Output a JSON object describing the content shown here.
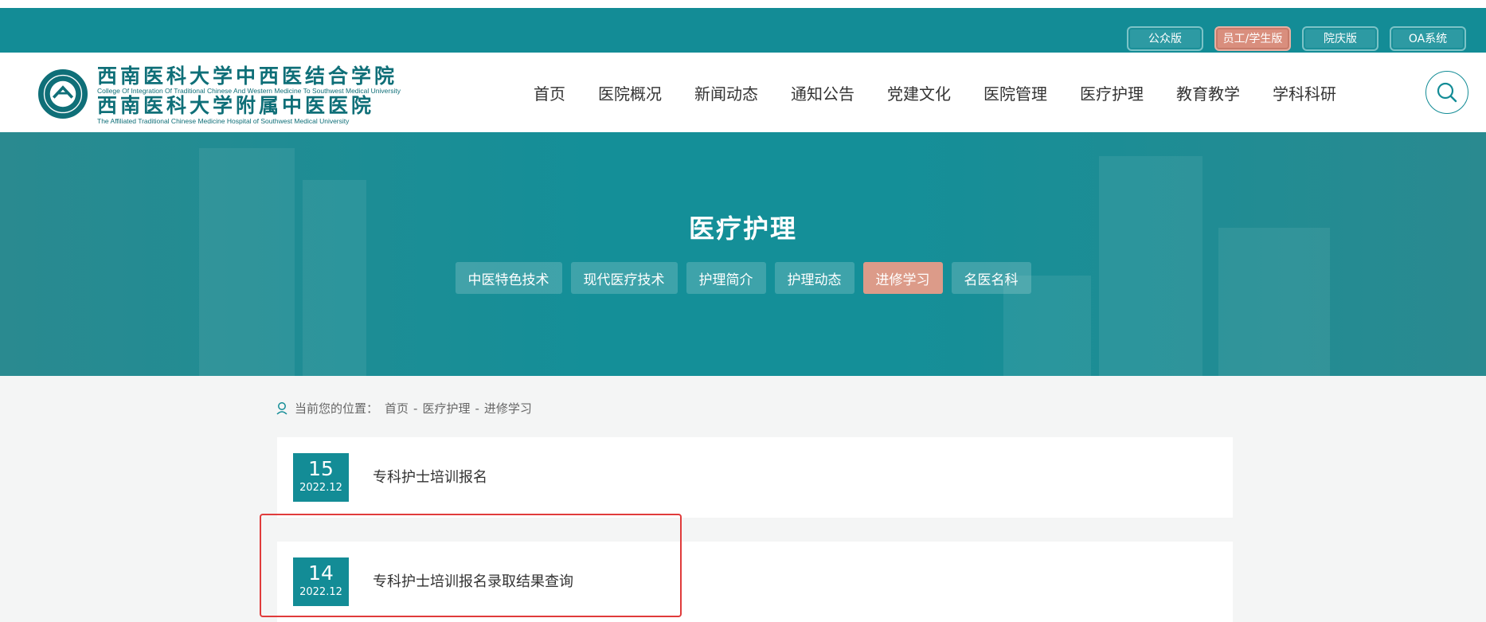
{
  "top_links": [
    {
      "label": "公众版",
      "active": false
    },
    {
      "label": "员工/学生版",
      "active": true
    },
    {
      "label": "院庆版",
      "active": false
    },
    {
      "label": "OA系统",
      "active": false
    }
  ],
  "logo": {
    "cn_line1": "西南医科大学中西医结合学院",
    "en_line1": "College Of Integration Of Traditional Chinese And Western Medicine To Southwest Medical University",
    "cn_line2": "西南医科大学附属中医医院",
    "en_line2": "The Affiliated Traditional Chinese Medicine Hospital of Southwest Medical University"
  },
  "nav": [
    "首页",
    "医院概况",
    "新闻动态",
    "通知公告",
    "党建文化",
    "医院管理",
    "医疗护理",
    "教育教学",
    "学科科研"
  ],
  "banner": {
    "title": "医疗护理",
    "subnav": [
      {
        "label": "中医特色技术",
        "active": false
      },
      {
        "label": "现代医疗技术",
        "active": false
      },
      {
        "label": "护理简介",
        "active": false
      },
      {
        "label": "护理动态",
        "active": false
      },
      {
        "label": "进修学习",
        "active": true
      },
      {
        "label": "名医名科",
        "active": false
      }
    ]
  },
  "breadcrumb": {
    "prefix": "当前您的位置：",
    "items": [
      "首页",
      "医疗护理",
      "进修学习"
    ],
    "separator": "-"
  },
  "list": [
    {
      "day": "15",
      "ym": "2022.12",
      "title": "专科护士培训报名"
    },
    {
      "day": "14",
      "ym": "2022.12",
      "title": "专科护士培训报名录取结果查询"
    }
  ],
  "colors": {
    "teal": "#138c96",
    "accent": "#dc9b89",
    "highlight": "#e03b3b"
  },
  "icons": {
    "search": "search-icon",
    "location": "location-pin-icon",
    "emblem": "hospital-emblem-icon"
  }
}
